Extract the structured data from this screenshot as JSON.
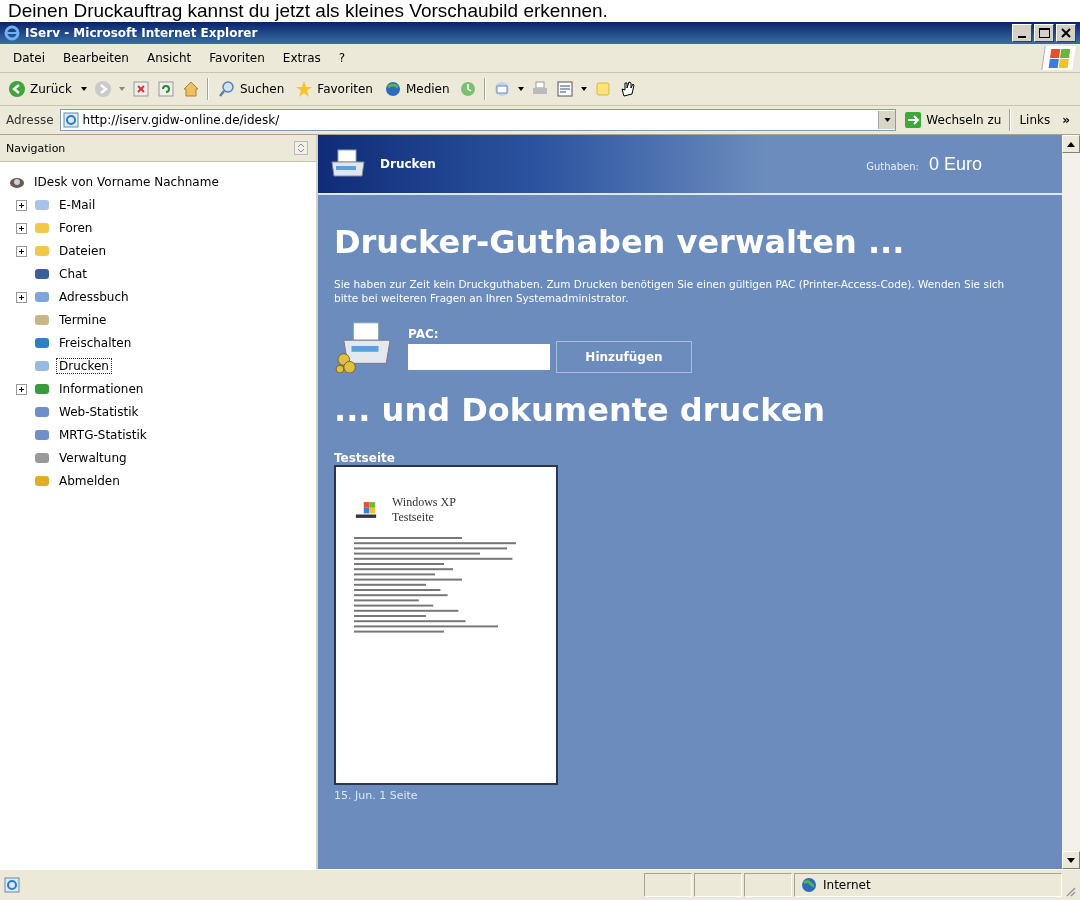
{
  "caption": "Deinen Druckauftrag kannst du jetzt als kleines Vorschaubild erkennen.",
  "window": {
    "title": "IServ - Microsoft Internet Explorer"
  },
  "menu": [
    "Datei",
    "Bearbeiten",
    "Ansicht",
    "Favoriten",
    "Extras",
    "?"
  ],
  "toolbar": {
    "back": "Zurück",
    "search": "Suchen",
    "favorites": "Favoriten",
    "media": "Medien"
  },
  "address": {
    "label": "Adresse",
    "url": "http://iserv.gidw-online.de/idesk/",
    "go": "Wechseln zu",
    "links": "Links",
    "more": "»"
  },
  "sidebar": {
    "title": "Navigation",
    "root": "IDesk von Vorname Nachname",
    "items": [
      {
        "label": "E-Mail",
        "expanded": false,
        "selected": false
      },
      {
        "label": "Foren",
        "expanded": false,
        "selected": false
      },
      {
        "label": "Dateien",
        "expanded": false,
        "selected": false
      },
      {
        "label": "Chat",
        "selected": false
      },
      {
        "label": "Adressbuch",
        "expanded": false,
        "selected": false
      },
      {
        "label": "Termine",
        "selected": false
      },
      {
        "label": "Freischalten",
        "selected": false
      },
      {
        "label": "Drucken",
        "selected": true
      },
      {
        "label": "Informationen",
        "expanded": false,
        "selected": false
      },
      {
        "label": "Web-Statistik",
        "selected": false
      },
      {
        "label": "MRTG-Statistik",
        "selected": false
      },
      {
        "label": "Verwaltung",
        "selected": false
      },
      {
        "label": "Abmelden",
        "selected": false
      }
    ]
  },
  "page": {
    "header": "Drucken",
    "balance_label": "Guthaben:",
    "balance": "0 Euro",
    "heading1": "Drucker-Guthaben verwalten ...",
    "text": "Sie haben zur Zeit kein Druckguthaben. Zum Drucken benötigen Sie einen gültigen PAC (Printer-Access-Code). Wenden Sie sich bitte bei weiteren Fragen an Ihren Systemadministrator.",
    "pac_label": "PAC:",
    "add_button": "Hinzufügen",
    "heading2": "... und Dokumente drucken",
    "document": {
      "title": "Testseite",
      "line1": "Windows XP",
      "line2": "Testseite",
      "caption": "15. Jun. 1 Seite"
    }
  },
  "status_bar": {
    "zone": "Internet"
  }
}
